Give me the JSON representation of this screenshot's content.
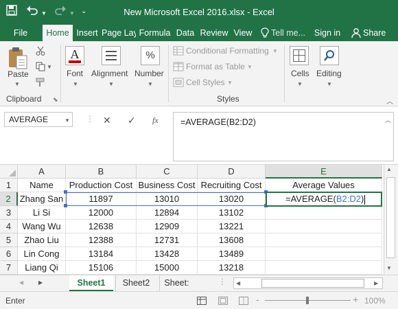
{
  "window": {
    "title": "New Microsoft Excel 2016.xlsx - Excel"
  },
  "quick_access": {
    "save_icon": "save-icon",
    "undo_icon": "undo-icon",
    "redo_icon": "redo-icon",
    "customize_icon": "customize-icon"
  },
  "tabs": [
    "File",
    "Home",
    "Insert",
    "Page Lay",
    "Formula",
    "Data",
    "Review",
    "View"
  ],
  "tell_me": "Tell me...",
  "sign_in": "Sign in",
  "share": "Share",
  "ribbon": {
    "paste": "Paste",
    "font": "Font",
    "alignment": "Alignment",
    "number": "Number",
    "number_icon_text": "%",
    "conditional_formatting": "Conditional Formatting",
    "format_as_table": "Format as Table",
    "cell_styles": "Cell Styles",
    "cells": "Cells",
    "editing": "Editing",
    "group_clipboard": "Clipboard",
    "group_styles": "Styles"
  },
  "formula_bar": {
    "name_box": "AVERAGE",
    "cancel_glyph": "✕",
    "enter_glyph": "✓",
    "fx_glyph": "fx",
    "formula": "=AVERAGE(B2:D2)"
  },
  "sheet": {
    "columns": [
      "A",
      "B",
      "C",
      "D",
      "E"
    ],
    "rows": [
      [
        "Name",
        "Production Cost",
        "Business Cost",
        "Recruiting Cost",
        "Average Values"
      ],
      [
        "Zhang San",
        "11897",
        "13010",
        "13020",
        ""
      ],
      [
        "Li Si",
        "12000",
        "12894",
        "13102",
        ""
      ],
      [
        "Wang Wu",
        "12638",
        "12909",
        "13221",
        ""
      ],
      [
        "Zhao Liu",
        "12388",
        "12731",
        "13608",
        ""
      ],
      [
        "Lin Cong",
        "13184",
        "13428",
        "13489",
        ""
      ],
      [
        "Liang Qi",
        "15106",
        "15000",
        "13218",
        ""
      ]
    ],
    "editing_cell": {
      "prefix": "=AVERAGE(",
      "ref": "B2:D2",
      "suffix": ")"
    },
    "colors": {
      "range_blue": "#4472c4",
      "excel_green": "#217346"
    }
  },
  "sheet_tabs": [
    "Sheet1",
    "Sheet2",
    "Sheet:"
  ],
  "status": {
    "mode": "Enter",
    "zoom": "100%",
    "zoom_minus": "-",
    "zoom_plus": "+"
  }
}
